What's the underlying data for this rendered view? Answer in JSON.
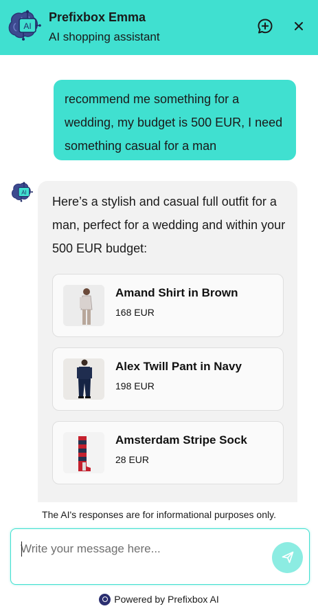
{
  "header": {
    "title": "Prefixbox Emma",
    "subtitle": "AI shopping assistant",
    "logo_icon": "ai-brain-icon",
    "logo_text": "AI",
    "new_chat_icon": "new-chat-icon",
    "close_icon": "close-icon",
    "accent_color": "#40e0d0"
  },
  "conversation": {
    "user_message": "recommend me something for a wedding, my budget is 500 EUR, I need something casual for a man",
    "assistant_avatar_icon": "ai-brain-icon",
    "assistant_message": "Here’s a stylish and casual full outfit for a man, perfect for a wedding and within your 500 EUR budget:",
    "products": [
      {
        "name": "Amand Shirt in Brown",
        "price": "168 EUR",
        "image_icon": "shirt-model-image"
      },
      {
        "name": "Alex Twill Pant in Navy",
        "price": "198 EUR",
        "image_icon": "pant-model-image"
      },
      {
        "name": "Amsterdam Stripe Sock",
        "price": "28 EUR",
        "image_icon": "sock-product-image"
      }
    ]
  },
  "footer": {
    "disclaimer": "The AI's responses are for informational purposes only.",
    "input_placeholder": "Write your message here...",
    "input_value": "",
    "send_icon": "send-icon",
    "powered_by": "Powered by Prefixbox AI",
    "powered_logo_icon": "prefixbox-logo-icon"
  }
}
